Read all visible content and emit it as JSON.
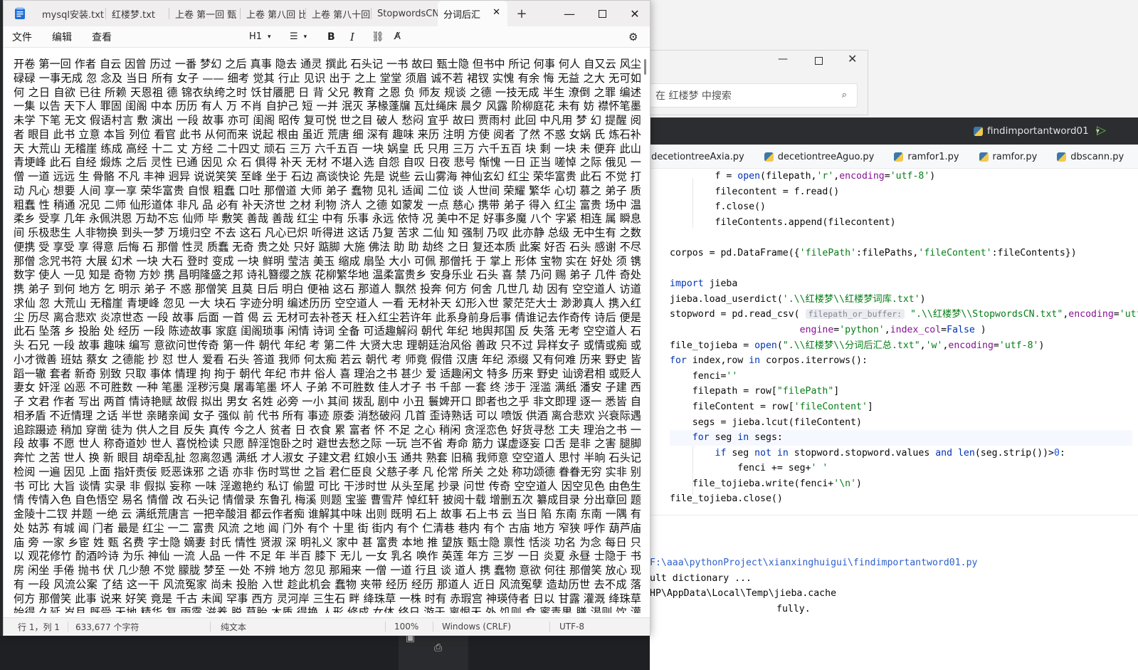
{
  "ide": {
    "run_config": "findimportantword01",
    "tabs": [
      "decetiontreeAxia.py",
      "decetiontreeAguo.py",
      "ramfor1.py",
      "ramfor.py",
      "dbscann.py"
    ],
    "hint_label": "filepath_or_buffer:",
    "console_lines": [
      "F:\\aaa\\pythonProject\\xianxinghuigui\\findimportantword01.py",
      "ult dictionary ...",
      "HP\\AppData\\Local\\Temp\\jieba.cache",
      "",
      "fully."
    ]
  },
  "search_window": {
    "placeholder": "在 红楼梦 中搜索"
  },
  "notepad": {
    "tabs": [
      "mysql安装.txt",
      "红楼梦.txt",
      "上卷 第一回 甄",
      "上卷 第八回 比",
      "上卷 第八十回",
      "StopwordsCN.txt",
      "分词后汇"
    ],
    "active_tab": "分词后汇",
    "menu": {
      "file": "文件",
      "edit": "编辑",
      "view": "查看",
      "heading": "H1"
    },
    "text": "开卷 第一回 作者 自云 因曾 历过 一番 梦幻 之后 真事 隐去 通灵 撰此 石头记 一书 故曰 甄士隐 但书中 所记 何事 何人 自又云 风尘碌碌 一事无成 忽 念及 当日 所有 女子 —— 细考 觉其 行止 见识 出于 之上 堂堂 须眉 诚不若 裙钗 实愧 有余 悔 无益 之大 无可如何 之日 自欲 已往 所赖 天恩祖 德 锦衣纨绔之时 饫甘餍肥 日 背 父兄 教育 之恩 负 师友 规谈 之德 一技无成 半生 潦倒 之罪 编述 一集 以告 天下人 罪固 闺阁 中本 历历 有人 万 不肖 自护己 短 一并 泯灭 茅椽蓬牖 瓦灶绳床 晨夕 风露 阶柳庭花 未有 妨 襟怀笔墨 未学 下笔 无文 假语村言 敷 演出 一段 故事 亦可 闺阁 昭传 复可悦 世之目 破人 愁闷 宜乎 故曰 贾雨村 此回 中凡用 梦 幻 提醒 阅者 眼目 此书 立意 本旨 列位 看官 此书 从何而来 说起 根由 虽近 荒唐 细 深有 趣味 来历 注明 方使 阅者 了然 不惑 女娲 氏 炼石补天 大荒山 无稽崖 练成 高经 十二 丈 方经 二十四丈 顽石 三万 六千五百 一块 娲皇 氏 只用 三万 六千五百 块 剩 一块 未 便弃 此山 青埂峰 此石 自经 煅炼 之后 灵性 已通 因见 众 石 俱得 补天 无材 不堪入选 自怨 自叹 日夜 悲号 惭愧 一日 正当 嗟悼 之际 俄见 一僧 一道 远远 生 骨骼 不凡 丰神 迥异 说说笑笑 至峰 坐于 石边 高谈快论 先是 说些 云山雾海 神仙玄幻 红尘 荣华富贵 此石 不觉 打动 凡心 想要 人间 享一享 荣华富贵 自恨 粗蠢 口吐 那僧道 大师 弟子 蠢物 见礼 适闻 二位 谈 人世间 荣耀 繁华 心切 慕之 弟子 质 粗蠢 性 稍通 况见 二师 仙形道体 非凡 品 必有 补天济世 之材 利物 济人 之德 如蒙发 一点 慈心 携带 弟子 得入 红尘 富贵 场中 温柔乡 受享 几年 永佩洪恩 万劫不忘 仙师 毕 敷笑 善哉 善哉 红尘 中有 乐事 永远 依恃 况 美中不足 好事多魔 八个 字紧 相连 属 瞬息间 乐极悲生 人非物换 到头一梦 万境归空 不去 这石 凡心已炽 听得进 这话 乃复 苦求 二仙 知 强制 乃叹 此亦静 总级 无中生有 之数 便携 受 享受 享 得意 后悔 石 那僧 性灵 质蠢 无奇 贵之处 只好 踮脚 大施 佛法 助 助 劫终 之日 复还本质 此案 好否 石头 感谢 不尽 那僧 念咒书符 大展 幻术 一块 大石 登时 变成 一块 鲜明 莹洁 美玉 缩成 扇坠 大小 可佩 那僧托 于 掌上 形体 宝物 实在 好处 须 镌 数字 使人 一见 知是 奇物 方妙 携 昌明隆盛之邦 诗礼簪缨之族 花柳繁华地 温柔富贵乡 安身乐业 石头 喜 禁 乃问 赐 弟子 几件 奇处 携 弟子 到何 地方 乞 明示 弟子 不惑 那僧笑 且莫 日后 明白 便袖 这石 那道人 飘然 投奔 何方 何舍 几世几 劫 因有 空空道人 访道求仙 忽 大荒山 无稽崖 青埂峰 忽见 一大 块石 字迹分明 编述历历 空空道人 一看 无材补天 幻形入世 蒙茫茫大士 渺渺真人 携入红尘 历尽 离合悲欢 炎凉世态 一段 故事 后面 一首 偈 云 无材可去补苍天 枉入红尘若许年 此系身前身后事 倩谁记去作奇传 诗后 便是 此石 坠落 乡 投胎 处 经历 一段 陈迹故事 家庭 闺阁琐事 闲情 诗词 全备 可适趣解闷 朝代 年纪 地舆邦国 反 失落 无考 空空道人 石头 石兄 一段 故事 趣味 编写 意欲问世传奇 第一件 朝代 年纪 考 第二件 大贤大忠 理朝廷治风俗 善政 只不过 异样女子 或情或痴 或 小才微善 班姑 蔡女 之德能 抄 怼 世人 爱看 石头 答道 我师 何太痴 若云 朝代 考 师竟 假借 汉唐 年纪 添缀 又有何难 历来 野史 皆蹈一辙 套者 新奇 别致 只取 事体 情理 拘 拘于 朝代 年纪 市井 俗人 喜 理治之书 甚少 爱 适趣闲文 特多 历来 野史 讪谤君相 或贬人妻女 奸淫 凶恶 不可胜数 一种 笔墨 淫秽污臭 屠毒笔墨 坏人 子弟 不可胜数 佳人才子 书 千部 一套 终 涉于 淫滥 满纸 潘安 子建 西子 文君 作者 写出 两首 情诗艳赋 故假 拟出 男女 名姓 必旁 一小 其间 拨乱 剧中 小丑 鬟婢开口 即者也之乎 非文即理 逐一 悉皆 自相矛盾 不近情理 之话 半世 亲睹亲闻 女子 强似 前 代书 所有 事迹 原委 消愁破闷 几首 歪诗熟话 可以 喷饭 供酒 离合悲欢 兴衰际遇 追踪蹑迹 稍加 穿凿 徒为 供人之目 反失 真传 今之人 贫者 日 衣食 累 富者 怀 不足 之心 稍闲 贪淫恋色 好货寻愁 工夫 理治之书 一段 故事 不愿 世人 称奇道妙 世人 喜悦检读 只愿 醉淫饱卧之时 避世去愁之际 一玩 岂不省 寿命 筋力 谋虚逐妄 口舌 是非 之害 腿脚 奔忙 之苦 世人 换 新 眼目 胡牵乱扯 忽离忽遇 满纸 才人淑女 子建文君 红娘小玉 通共 熟套 旧稿 我师意 空空道人 思忖 半晌 石头记 检阅 一遍 因见 上面 指奸责佞 贬恶诛邪 之语 亦非 伤时骂世 之旨 君仁臣良 父慈子孝 凡 伦常 所关 之处 称功颂德 眷眷无穷 实非 别书 可比 大旨 谈情 实录 非 假拟 妄称 一味 淫邀艳约 私订 偷盟 可比 干涉时世 从头至尾 抄录 问世 传奇 空空道人 因空见色 由色生情 传情入色 自色悟空 易名 情僧 改 石头记 情僧录 东鲁孔 梅溪 则题 宝鉴 曹雪芹 悼红轩 披阅十载 增删五次 纂成目录 分出章回 题 金陵十二钗 并题 一绝 云 满纸荒唐言 一把辛酸泪 都云作者痴 谁解其中味 出则 既明 石上 故事 石上书 云 当日 陷 东南 东南 一隅 有处 姑苏 有城 阊 门者 最是 红尘 一二 富贵 风流 之地 阊 门外 有个 十里 街 街内 有个 仁清巷 巷内 有个 古庙 地方 窄狭 呼作 葫芦庙 庙 旁 一家 乡宦 姓 甄 名费 字士隐 嫡妻 封氏 情性 贤淑 深 明礼义 家中 甚 富贵 本地 推 望族 甄士隐 禀性 恬淡 功名 为念 每日 只以 观花修竹 酌酒吟诗 为乐 神仙 一流 人品 一件 不足 年 半百 膝下 无儿 一女 乳名 唤作 英莲 年方 三岁 一日 炎夏 永昼 士隐于 书房 闲坐 手倦 抛书 伏 几少憩 不觉 朦胧 梦至 一处 不辨 地方 忽见 那厢来 一僧 一道 行且 谈 道人 携 蠢物 意欲 何往 那僧笑 放心 现有 一段 风流公案 了结 这一干 风流冤家 尚未 投胎 入世 趁此机会 蠢物 夹带 经历 经历 那道人 近日 风流冤孽 造劫历世 去不成 落 何方 那僧笑 此事 说来 好笑 竟是 千古 未闻 罕事 西方 灵河岸 三生石 畔 绛珠草 一株 时有 赤瑕宫 神瑛侍者 日以 甘露 灌溉 绛珠草 始得 久延 岁月 既受 天地 精华 复 雨露 滋养 脱 草胎 木质 得换 人形 修成 女体 终日 游于 离恨天 外 饥则 食 蜜青果 膳 渴则 饮 灌愁海 水为 汤 尚未 酬报灌溉之德 故其五内 郁结 一段 缠绵不尽之意 恰 近日 神瑛侍者 凡心 偶炽 乘此 昌明太平朝世 意欲 下凡 造历幻缘 警幻仙子 案前 挂 号 警幻 曾 问及 灌溉 之情 未偿 趁此 了结 绛珠仙子 甘露之惠 无此 水 下世 下世 一生 所有 眼泪 偿还 一事",
    "status": {
      "position": "行 1，列 1",
      "chars": "633,677 个字符",
      "format": "纯文本",
      "zoom": "100%",
      "eol": "Windows (CRLF)",
      "encoding": "UTF-8"
    }
  }
}
